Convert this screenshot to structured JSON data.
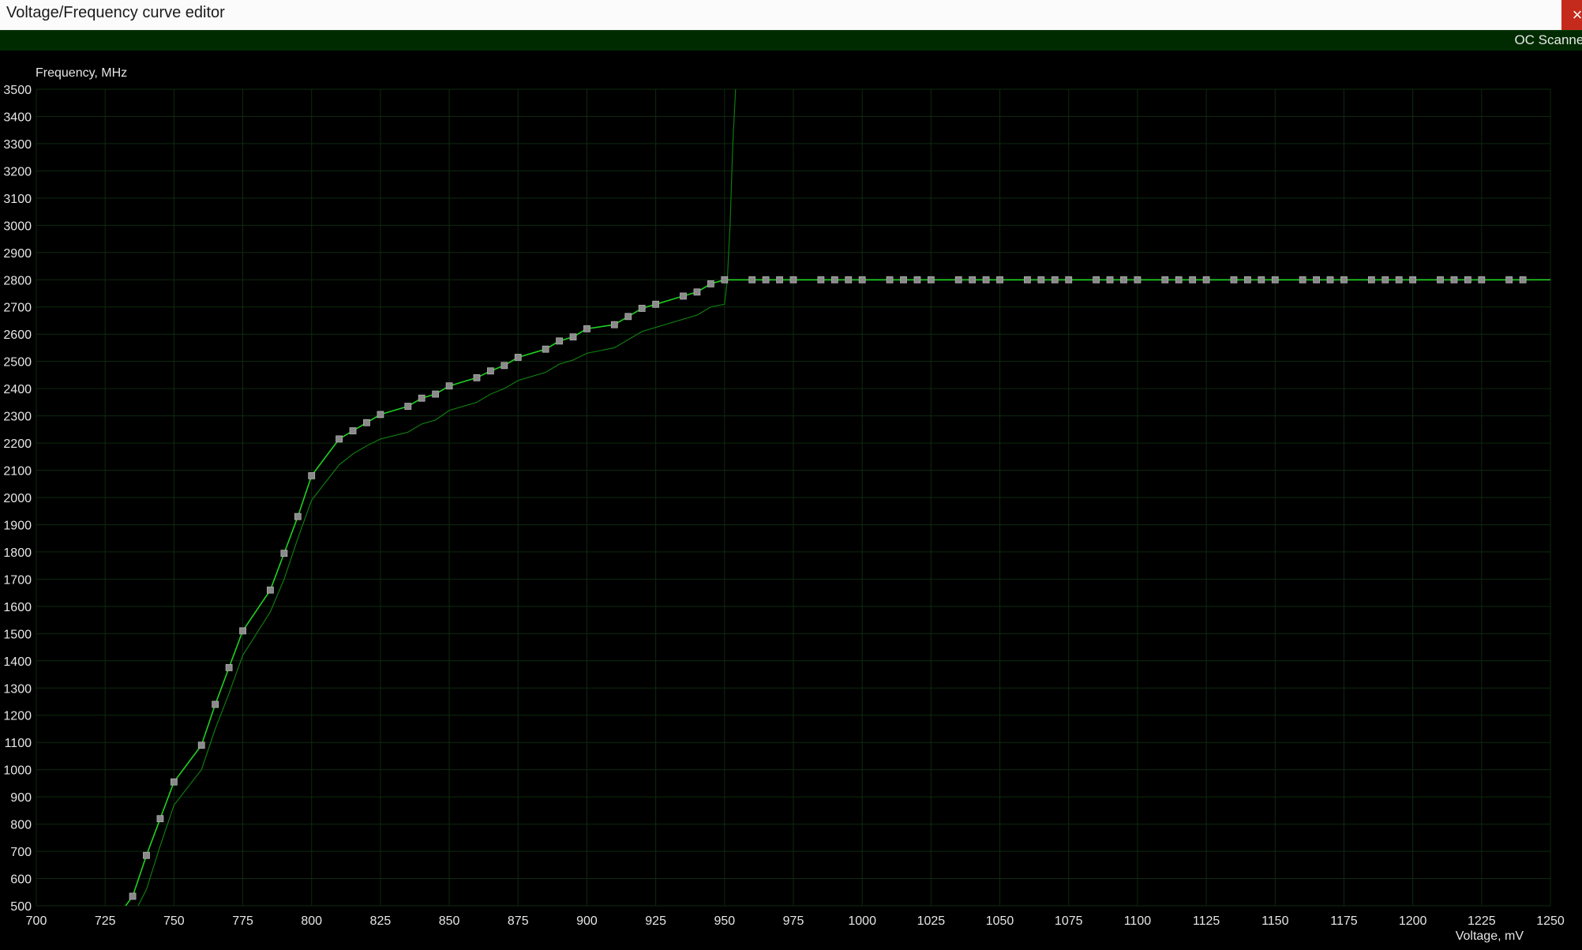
{
  "window": {
    "title": "Voltage/Frequency curve editor",
    "close_glyph": "×"
  },
  "toolbar": {
    "oc_scanner_label": "OC Scanner"
  },
  "colors": {
    "background": "#000000",
    "grid": "#0e2a0e",
    "curve": "#1fd01f",
    "default_curve": "#0f7a0f",
    "point_fill": "#8a8a8a",
    "point_stroke": "#b0b0b0",
    "status_strip": "#002b00",
    "close_button": "#c42b1c"
  },
  "chart_data": {
    "type": "line",
    "ylabel": "Frequency, MHz",
    "xlabel": "Voltage, mV",
    "xlim": [
      700,
      1250
    ],
    "ylim": [
      500,
      3500
    ],
    "grid": true,
    "xticks": [
      700,
      725,
      750,
      775,
      800,
      825,
      850,
      875,
      900,
      925,
      950,
      975,
      1000,
      1025,
      1050,
      1075,
      1100,
      1125,
      1150,
      1175,
      1200,
      1225,
      1250
    ],
    "yticks": [
      500,
      600,
      700,
      800,
      900,
      1000,
      1100,
      1200,
      1300,
      1400,
      1500,
      1600,
      1700,
      1800,
      1900,
      2000,
      2100,
      2200,
      2300,
      2400,
      2500,
      2600,
      2700,
      2800,
      2900,
      3000,
      3100,
      3200,
      3300,
      3400,
      3500
    ],
    "series": [
      {
        "role": "edited-curve",
        "points": [
          [
            731,
            480
          ],
          [
            735,
            535
          ],
          [
            740,
            685
          ],
          [
            745,
            820
          ],
          [
            750,
            955
          ],
          [
            760,
            1090
          ],
          [
            765,
            1240
          ],
          [
            770,
            1375
          ],
          [
            775,
            1510
          ],
          [
            785,
            1660
          ],
          [
            790,
            1795
          ],
          [
            795,
            1930
          ],
          [
            800,
            2080
          ],
          [
            810,
            2215
          ],
          [
            815,
            2245
          ],
          [
            820,
            2275
          ],
          [
            825,
            2305
          ],
          [
            835,
            2335
          ],
          [
            840,
            2365
          ],
          [
            845,
            2380
          ],
          [
            850,
            2410
          ],
          [
            860,
            2440
          ],
          [
            865,
            2465
          ],
          [
            870,
            2485
          ],
          [
            875,
            2515
          ],
          [
            885,
            2545
          ],
          [
            890,
            2575
          ],
          [
            895,
            2590
          ],
          [
            900,
            2620
          ],
          [
            910,
            2635
          ],
          [
            915,
            2665
          ],
          [
            920,
            2695
          ],
          [
            925,
            2710
          ],
          [
            935,
            2740
          ],
          [
            940,
            2755
          ],
          [
            945,
            2785
          ],
          [
            950,
            2800
          ],
          [
            960,
            2800
          ],
          [
            965,
            2800
          ],
          [
            970,
            2800
          ],
          [
            975,
            2800
          ],
          [
            985,
            2800
          ],
          [
            990,
            2800
          ],
          [
            995,
            2800
          ],
          [
            1000,
            2800
          ],
          [
            1010,
            2800
          ],
          [
            1015,
            2800
          ],
          [
            1020,
            2800
          ],
          [
            1025,
            2800
          ],
          [
            1035,
            2800
          ],
          [
            1040,
            2800
          ],
          [
            1045,
            2800
          ],
          [
            1050,
            2800
          ],
          [
            1060,
            2800
          ],
          [
            1065,
            2800
          ],
          [
            1070,
            2800
          ],
          [
            1075,
            2800
          ],
          [
            1085,
            2800
          ],
          [
            1090,
            2800
          ],
          [
            1095,
            2800
          ],
          [
            1100,
            2800
          ],
          [
            1110,
            2800
          ],
          [
            1115,
            2800
          ],
          [
            1120,
            2800
          ],
          [
            1125,
            2800
          ],
          [
            1135,
            2800
          ],
          [
            1140,
            2800
          ],
          [
            1145,
            2800
          ],
          [
            1150,
            2800
          ],
          [
            1160,
            2800
          ],
          [
            1165,
            2800
          ],
          [
            1170,
            2800
          ],
          [
            1175,
            2800
          ],
          [
            1185,
            2800
          ],
          [
            1190,
            2800
          ],
          [
            1195,
            2800
          ],
          [
            1200,
            2800
          ],
          [
            1210,
            2800
          ],
          [
            1215,
            2800
          ],
          [
            1220,
            2800
          ],
          [
            1225,
            2800
          ],
          [
            1235,
            2800
          ],
          [
            1240,
            2800
          ]
        ]
      },
      {
        "role": "default-curve",
        "points": [
          [
            736,
            480
          ],
          [
            740,
            560
          ],
          [
            745,
            720
          ],
          [
            750,
            870
          ],
          [
            760,
            1000
          ],
          [
            765,
            1150
          ],
          [
            770,
            1280
          ],
          [
            775,
            1420
          ],
          [
            785,
            1580
          ],
          [
            790,
            1700
          ],
          [
            795,
            1850
          ],
          [
            800,
            1990
          ],
          [
            810,
            2120
          ],
          [
            815,
            2160
          ],
          [
            820,
            2190
          ],
          [
            825,
            2215
          ],
          [
            835,
            2240
          ],
          [
            840,
            2270
          ],
          [
            845,
            2285
          ],
          [
            850,
            2320
          ],
          [
            860,
            2350
          ],
          [
            865,
            2380
          ],
          [
            870,
            2400
          ],
          [
            875,
            2430
          ],
          [
            885,
            2460
          ],
          [
            890,
            2490
          ],
          [
            895,
            2505
          ],
          [
            900,
            2530
          ],
          [
            910,
            2550
          ],
          [
            915,
            2580
          ],
          [
            920,
            2610
          ],
          [
            925,
            2625
          ],
          [
            935,
            2655
          ],
          [
            940,
            2670
          ],
          [
            945,
            2700
          ],
          [
            950,
            2710
          ],
          [
            951,
            2800
          ],
          [
            952,
            3000
          ],
          [
            953,
            3300
          ],
          [
            954,
            3500
          ]
        ]
      },
      {
        "role": "flat-line",
        "points": [
          [
            950,
            2800
          ],
          [
            1250,
            2800
          ]
        ]
      }
    ]
  }
}
